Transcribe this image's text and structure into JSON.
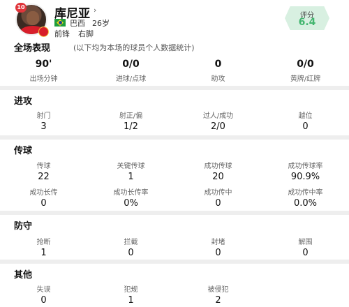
{
  "player": {
    "number": "10",
    "name": "库尼亚",
    "arrow": "›",
    "country": "巴西",
    "age": "26岁",
    "position": "前锋",
    "foot": "右脚",
    "rating_label": "评分",
    "rating_value": "6.4",
    "colors": {
      "rating_bg": "#d8f0e1",
      "rating_text": "#43b66f",
      "badge": "#e0353b"
    }
  },
  "overview": {
    "title": "全场表现",
    "subtitle": "(以下均为本场的球员个人数据统计)",
    "stats": [
      {
        "value": "90'",
        "label": "出场分钟"
      },
      {
        "value": "0/0",
        "label": "进球/点球"
      },
      {
        "value": "0",
        "label": "助攻"
      },
      {
        "value": "0/0",
        "label": "黄牌/红牌"
      }
    ]
  },
  "attack": {
    "title": "进攻",
    "stats": [
      {
        "label": "射门",
        "value": "3"
      },
      {
        "label": "射正/偏",
        "value": "1/2"
      },
      {
        "label": "过人/成功",
        "value": "2/0"
      },
      {
        "label": "越位",
        "value": "0"
      }
    ]
  },
  "passing": {
    "title": "传球",
    "stats": [
      {
        "label": "传球",
        "value": "22"
      },
      {
        "label": "关键传球",
        "value": "1"
      },
      {
        "label": "成功传球",
        "value": "20"
      },
      {
        "label": "成功传球率",
        "value": "90.9%"
      },
      {
        "label": "成功长传",
        "value": "0"
      },
      {
        "label": "成功长传率",
        "value": "0%"
      },
      {
        "label": "成功传中",
        "value": "0"
      },
      {
        "label": "成功传中率",
        "value": "0.0%"
      }
    ]
  },
  "defense": {
    "title": "防守",
    "stats": [
      {
        "label": "抢断",
        "value": "1"
      },
      {
        "label": "拦截",
        "value": "0"
      },
      {
        "label": "封堵",
        "value": "0"
      },
      {
        "label": "解围",
        "value": "0"
      }
    ]
  },
  "other": {
    "title": "其他",
    "stats": [
      {
        "label": "失误",
        "value": "0"
      },
      {
        "label": "犯规",
        "value": "1"
      },
      {
        "label": "被侵犯",
        "value": "2"
      }
    ]
  }
}
